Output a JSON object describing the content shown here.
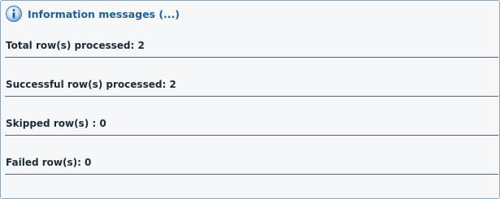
{
  "panel": {
    "title": "Information messages (...)",
    "icon": "info-icon"
  },
  "rows": [
    {
      "label": "Total row(s) processed: 2"
    },
    {
      "label": "Successful row(s) processed: 2"
    },
    {
      "label": "Skipped row(s) : 0"
    },
    {
      "label": "Failed row(s): 0"
    }
  ]
}
